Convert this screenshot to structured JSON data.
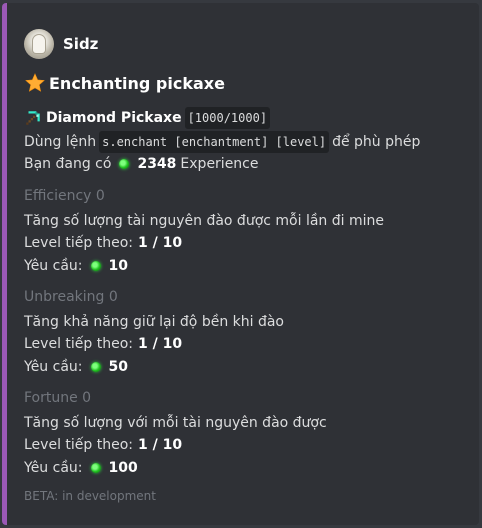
{
  "author": {
    "name": "Sidz"
  },
  "title": "Enchanting pickaxe",
  "item": {
    "name": "Diamond Pickaxe",
    "durability": "[1000/1000]"
  },
  "usage": {
    "prefix": "Dùng lệnh",
    "command": "s.enchant [enchantment] [level]",
    "suffix": "để phù phép"
  },
  "experience": {
    "prefix": "Bạn đang có",
    "amount": "2348",
    "suffix": "Experience"
  },
  "enchantments": [
    {
      "header": "Efficiency 0",
      "description": "Tăng số lượng tài nguyên đào được mỗi lần đi mine",
      "level_label": "Level tiếp theo:",
      "level_value": "1 / 10",
      "req_label": "Yêu cầu:",
      "req_value": "10"
    },
    {
      "header": "Unbreaking 0",
      "description": "Tăng khả năng giữ lại độ bền khi đào",
      "level_label": "Level tiếp theo:",
      "level_value": "1 / 10",
      "req_label": "Yêu cầu:",
      "req_value": "50"
    },
    {
      "header": "Fortune 0",
      "description": "Tăng số lượng với mỗi tài nguyên đào được",
      "level_label": "Level tiếp theo:",
      "level_value": "1 / 10",
      "req_label": "Yêu cầu:",
      "req_value": "100"
    }
  ],
  "footer": "BETA: in development",
  "colors": {
    "accent": "#9b59b6",
    "background": "#2f3136",
    "muted": "#72767d"
  },
  "icons": {
    "title": "star-icon",
    "item": "diamond-pickaxe-icon",
    "currency": "experience-orb-icon"
  }
}
